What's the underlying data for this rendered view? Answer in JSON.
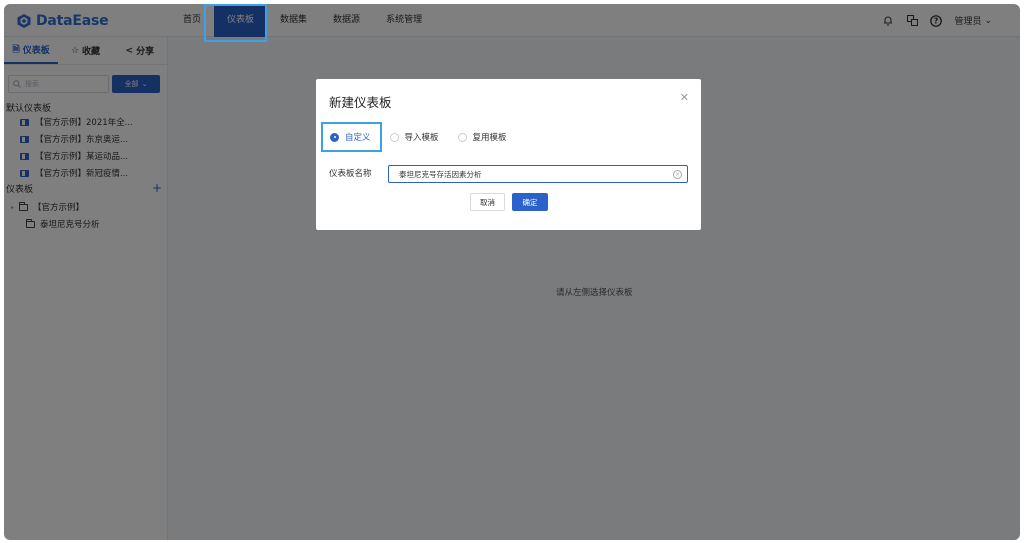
{
  "app": {
    "name": "DataEase"
  },
  "nav": {
    "items": [
      {
        "label": "首页"
      },
      {
        "label": "仪表板"
      },
      {
        "label": "数据集"
      },
      {
        "label": "数据源"
      },
      {
        "label": "系统管理"
      }
    ],
    "active_index": 1
  },
  "header": {
    "user_label": "管理员",
    "icons": [
      "bell-icon",
      "translate-icon",
      "help-icon"
    ]
  },
  "sidebar": {
    "tabs": [
      {
        "label": "仪表板",
        "icon": "document-icon"
      },
      {
        "label": "收藏",
        "icon": "star-icon"
      },
      {
        "label": "分享",
        "icon": "share-icon"
      }
    ],
    "search_placeholder": "搜索",
    "filter_label": "全部",
    "default_section_title": "默认仪表板",
    "default_items": [
      "【官方示例】2021年全...",
      "【官方示例】东京奥运...",
      "【官方示例】某运动品...",
      "【官方示例】新冠疫情..."
    ],
    "panel_section_title": "仪表板",
    "tree": [
      {
        "label": "【官方示例】"
      },
      {
        "label": "泰坦尼克号分析"
      }
    ]
  },
  "main": {
    "empty_hint": "请从左侧选择仪表板"
  },
  "dialog": {
    "title": "新建仪表板",
    "options": [
      {
        "label": "自定义",
        "checked": true
      },
      {
        "label": "导入模板",
        "checked": false
      },
      {
        "label": "复用模板",
        "checked": false
      }
    ],
    "name_label": "仪表板名称",
    "name_value": "泰坦尼克号存活因素分析",
    "cancel_label": "取消",
    "confirm_label": "确定"
  },
  "colors": {
    "brand": "#2a62c9",
    "highlight": "#3fa0e6"
  }
}
